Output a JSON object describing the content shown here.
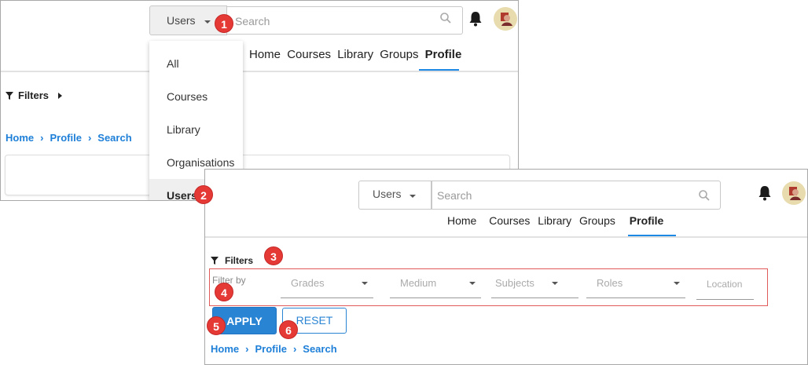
{
  "panel_top": {
    "scope_selector": {
      "value": "Users"
    },
    "search": {
      "placeholder": "Search"
    },
    "nav_tabs": [
      "Home",
      "Courses",
      "Library",
      "Groups",
      "Profile"
    ],
    "active_tab": "Profile",
    "filters_label": "Filters",
    "breadcrumb": [
      "Home",
      "Profile",
      "Search"
    ],
    "dropdown_menu": {
      "items": [
        "All",
        "Courses",
        "Library",
        "Organisations",
        "Users"
      ],
      "selected": "Users"
    }
  },
  "panel_bottom": {
    "scope_selector": {
      "value": "Users"
    },
    "search": {
      "placeholder": "Search"
    },
    "nav_tabs": [
      "Home",
      "Courses",
      "Library",
      "Groups",
      "Profile"
    ],
    "active_tab": "Profile",
    "filters_label": "Filters",
    "filter_by_label": "Filter by",
    "filter_fields": [
      {
        "label": "Grades",
        "type": "dropdown"
      },
      {
        "label": "Medium",
        "type": "dropdown"
      },
      {
        "label": "Subjects",
        "type": "dropdown"
      },
      {
        "label": "Roles",
        "type": "dropdown"
      },
      {
        "label": "Location",
        "type": "text"
      }
    ],
    "apply_label": "APPLY",
    "reset_label": "RESET",
    "breadcrumb": [
      "Home",
      "Profile",
      "Search"
    ]
  },
  "callouts": [
    "1",
    "2",
    "3",
    "4",
    "5",
    "6"
  ],
  "colors": {
    "accent": "#1e88e5",
    "link": "#1e7fd8",
    "callout": "#e53935",
    "filter_row_border": "#e05a5a"
  },
  "icons": [
    "search-icon",
    "bell-icon",
    "avatar",
    "filter-icon",
    "caret-down-icon",
    "chevron-right-icon"
  ]
}
